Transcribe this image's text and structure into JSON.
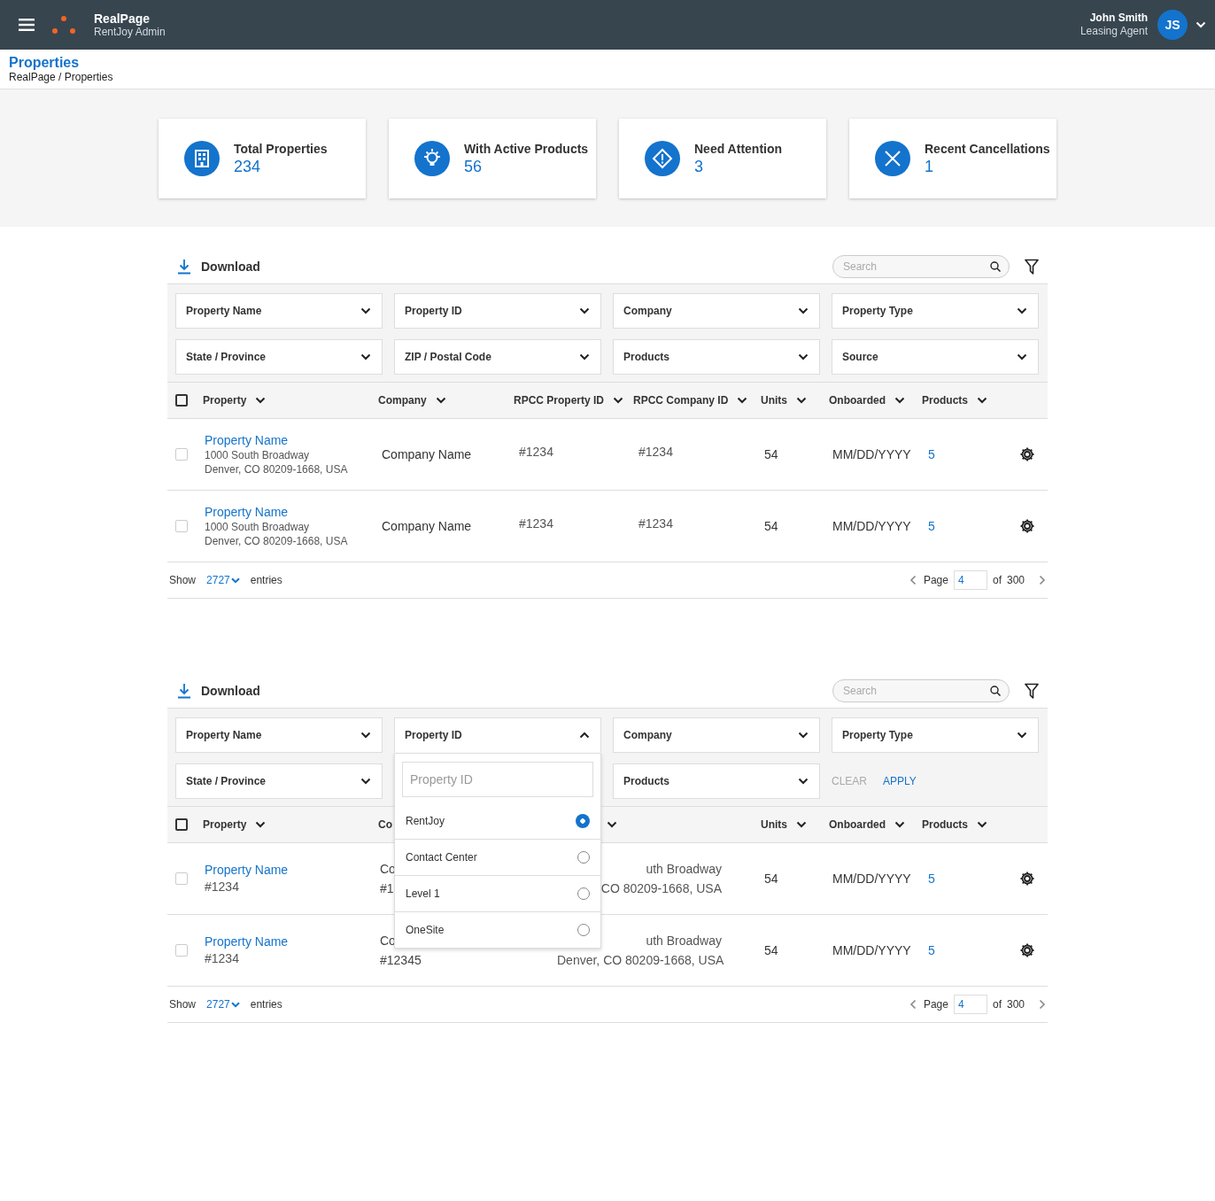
{
  "app_bar": {
    "brand": "RealPage",
    "subtitle": "RentJoy Admin",
    "user": {
      "name": "John Smith",
      "role": "Leasing Agent",
      "initials": "JS"
    }
  },
  "page_header": {
    "title": "Properties",
    "breadcrumb": "RealPage / Properties"
  },
  "stats": [
    {
      "kind": "building",
      "label": "Total Properties",
      "value": "234"
    },
    {
      "kind": "bulb",
      "label": "With Active Products",
      "value": "56"
    },
    {
      "kind": "alert",
      "label": "Need Attention",
      "value": "3"
    },
    {
      "kind": "cancel",
      "label": "Recent Cancellations",
      "value": "1"
    }
  ],
  "panels": [
    {
      "download": "Download",
      "search": {
        "placeholder": "Search"
      },
      "filters": [
        {
          "label": "Property Name",
          "expanded": false
        },
        {
          "label": "Property ID",
          "expanded": false
        },
        {
          "label": "Company",
          "expanded": false
        },
        {
          "label": "Property Type",
          "expanded": false
        },
        {
          "label": "State / Province",
          "expanded": false
        },
        {
          "label": "ZIP / Postal Code",
          "expanded": false
        },
        {
          "label": "Products",
          "expanded": false
        },
        {
          "label": "Source",
          "expanded": false
        }
      ],
      "table": {
        "all_checked": false,
        "columns": [
          {
            "label": "Property",
            "sortable": true
          },
          {
            "label": "Company",
            "sortable": true
          },
          {
            "label": "RPCC Property ID",
            "sortable": true
          },
          {
            "label": "RPCC Company ID",
            "sortable": true
          },
          {
            "label": "Units",
            "sortable": true
          },
          {
            "label": "Onboarded",
            "sortable": true
          },
          {
            "label": "Products",
            "sortable": true
          }
        ],
        "rows": [
          {
            "checked": false,
            "cells": [
              {
                "kind": "property",
                "name": "Property Name",
                "lines": [
                  "1000 South Broadway",
                  "Denver, CO 80209-1668, USA"
                ]
              },
              {
                "kind": "text",
                "lines": [
                  "Company Name"
                ]
              },
              {
                "kind": "id",
                "lines": [
                  "#1234"
                ]
              },
              {
                "kind": "id",
                "lines": [
                  "#1234"
                ]
              },
              {
                "kind": "text",
                "lines": [
                  "54"
                ]
              },
              {
                "kind": "text",
                "lines": [
                  "MM/DD/YYYY"
                ]
              },
              {
                "kind": "link",
                "lines": [
                  "5"
                ]
              }
            ]
          },
          {
            "checked": false,
            "cells": [
              {
                "kind": "property",
                "name": "Property Name",
                "lines": [
                  "1000 South Broadway",
                  "Denver, CO 80209-1668, USA"
                ]
              },
              {
                "kind": "text",
                "lines": [
                  "Company Name"
                ]
              },
              {
                "kind": "id",
                "lines": [
                  "#1234"
                ]
              },
              {
                "kind": "id",
                "lines": [
                  "#1234"
                ]
              },
              {
                "kind": "text",
                "lines": [
                  "54"
                ]
              },
              {
                "kind": "text",
                "lines": [
                  "MM/DD/YYYY"
                ]
              },
              {
                "kind": "link",
                "lines": [
                  "5"
                ]
              }
            ]
          }
        ]
      },
      "footer": {
        "show": "Show",
        "page_size": "2727",
        "entries": "entries",
        "page_label": "Page",
        "page": "4",
        "of": "of",
        "total": "300"
      }
    },
    {
      "download": "Download",
      "search": {
        "placeholder": "Search"
      },
      "filters": [
        {
          "label": "Property Name",
          "expanded": false
        },
        {
          "label": "Property ID",
          "expanded": true,
          "dropdown": {
            "placeholder": "Property ID",
            "options": [
              {
                "label": "RentJoy",
                "selected": true
              },
              {
                "label": "Contact Center",
                "selected": false
              },
              {
                "label": "Level 1",
                "selected": false
              },
              {
                "label": "OneSite",
                "selected": false
              }
            ]
          }
        },
        {
          "label": "Company",
          "expanded": false
        },
        {
          "label": "Property Type",
          "expanded": false
        },
        {
          "label": "State / Province",
          "expanded": false
        },
        {
          "label": "Products",
          "expanded": false
        }
      ],
      "actions": [
        {
          "label": "CLEAR",
          "disabled": true
        },
        {
          "label": "APPLY",
          "disabled": false
        }
      ],
      "table": {
        "all_checked": false,
        "columns": [
          {
            "label": "Property",
            "sortable": true
          },
          {
            "label": "Co",
            "sortable": false
          },
          {
            "sortable": true
          },
          {
            "label": "Units",
            "sortable": true
          },
          {
            "label": "Onboarded",
            "sortable": true
          },
          {
            "label": "Products",
            "sortable": true
          }
        ],
        "rows": [
          {
            "checked": false,
            "cells": [
              {
                "kind": "property_id",
                "name": "Property Name",
                "lines": [
                  "#1234"
                ]
              },
              {
                "kind": "stack",
                "lines": [
                  "Co",
                  "#1"
                ]
              },
              {
                "kind": "address",
                "lines": [
                  "uth Broadway",
                  "CO 80209-1668, USA"
                ]
              },
              {
                "kind": "text",
                "lines": [
                  "54"
                ]
              },
              {
                "kind": "text",
                "lines": [
                  "MM/DD/YYYY"
                ]
              },
              {
                "kind": "link",
                "lines": [
                  "5"
                ]
              }
            ]
          },
          {
            "checked": false,
            "cells": [
              {
                "kind": "property_id",
                "name": "Property Name",
                "lines": [
                  "#1234"
                ]
              },
              {
                "kind": "stack",
                "lines": [
                  "Co",
                  "#12345"
                ]
              },
              {
                "kind": "address",
                "lines": [
                  "uth Broadway",
                  "Denver, CO 80209-1668, USA"
                ]
              },
              {
                "kind": "text",
                "lines": [
                  "54"
                ]
              },
              {
                "kind": "text",
                "lines": [
                  "MM/DD/YYYY"
                ]
              },
              {
                "kind": "link",
                "lines": [
                  "5"
                ]
              }
            ]
          }
        ]
      },
      "footer": {
        "show": "Show",
        "page_size": "2727",
        "entries": "entries",
        "page_label": "Page",
        "page": "4",
        "of": "of",
        "total": "300"
      }
    }
  ]
}
